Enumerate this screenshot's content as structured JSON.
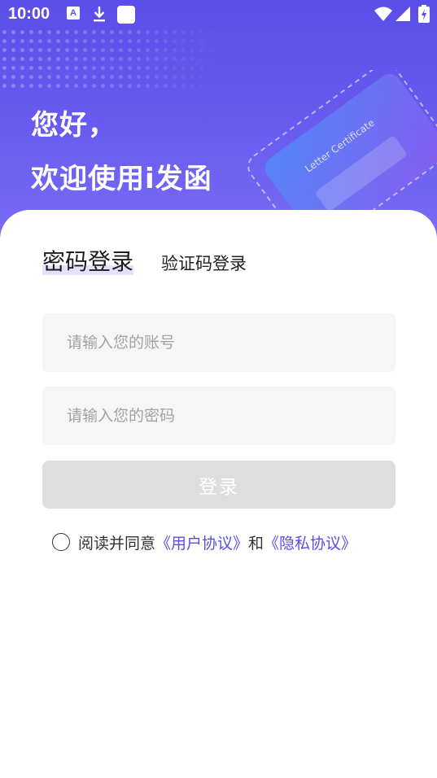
{
  "status_bar": {
    "time": "10:00",
    "icons": [
      "a-badge-icon",
      "download-icon",
      "square-icon",
      "wifi-icon",
      "cell-signal-icon",
      "battery-charging-icon"
    ]
  },
  "header": {
    "greeting_line1": "您好，",
    "greeting_line2": "欢迎使用i发函",
    "card_text": "Letter Certificate"
  },
  "tabs": [
    {
      "label": "密码登录",
      "active": true
    },
    {
      "label": "验证码登录",
      "active": false
    }
  ],
  "form": {
    "account_placeholder": "请输入您的账号",
    "account_value": "",
    "password_placeholder": "请输入您的密码",
    "password_value": "",
    "login_label": "登录"
  },
  "agreement": {
    "prefix": "阅读并同意",
    "user_agreement": "《用户协议》",
    "and": "和",
    "privacy_policy": "《隐私协议》",
    "checked": false
  },
  "colors": {
    "brand": "#5b4ee8",
    "button_disabled": "#dedede",
    "field_bg": "#f6f6f6"
  }
}
